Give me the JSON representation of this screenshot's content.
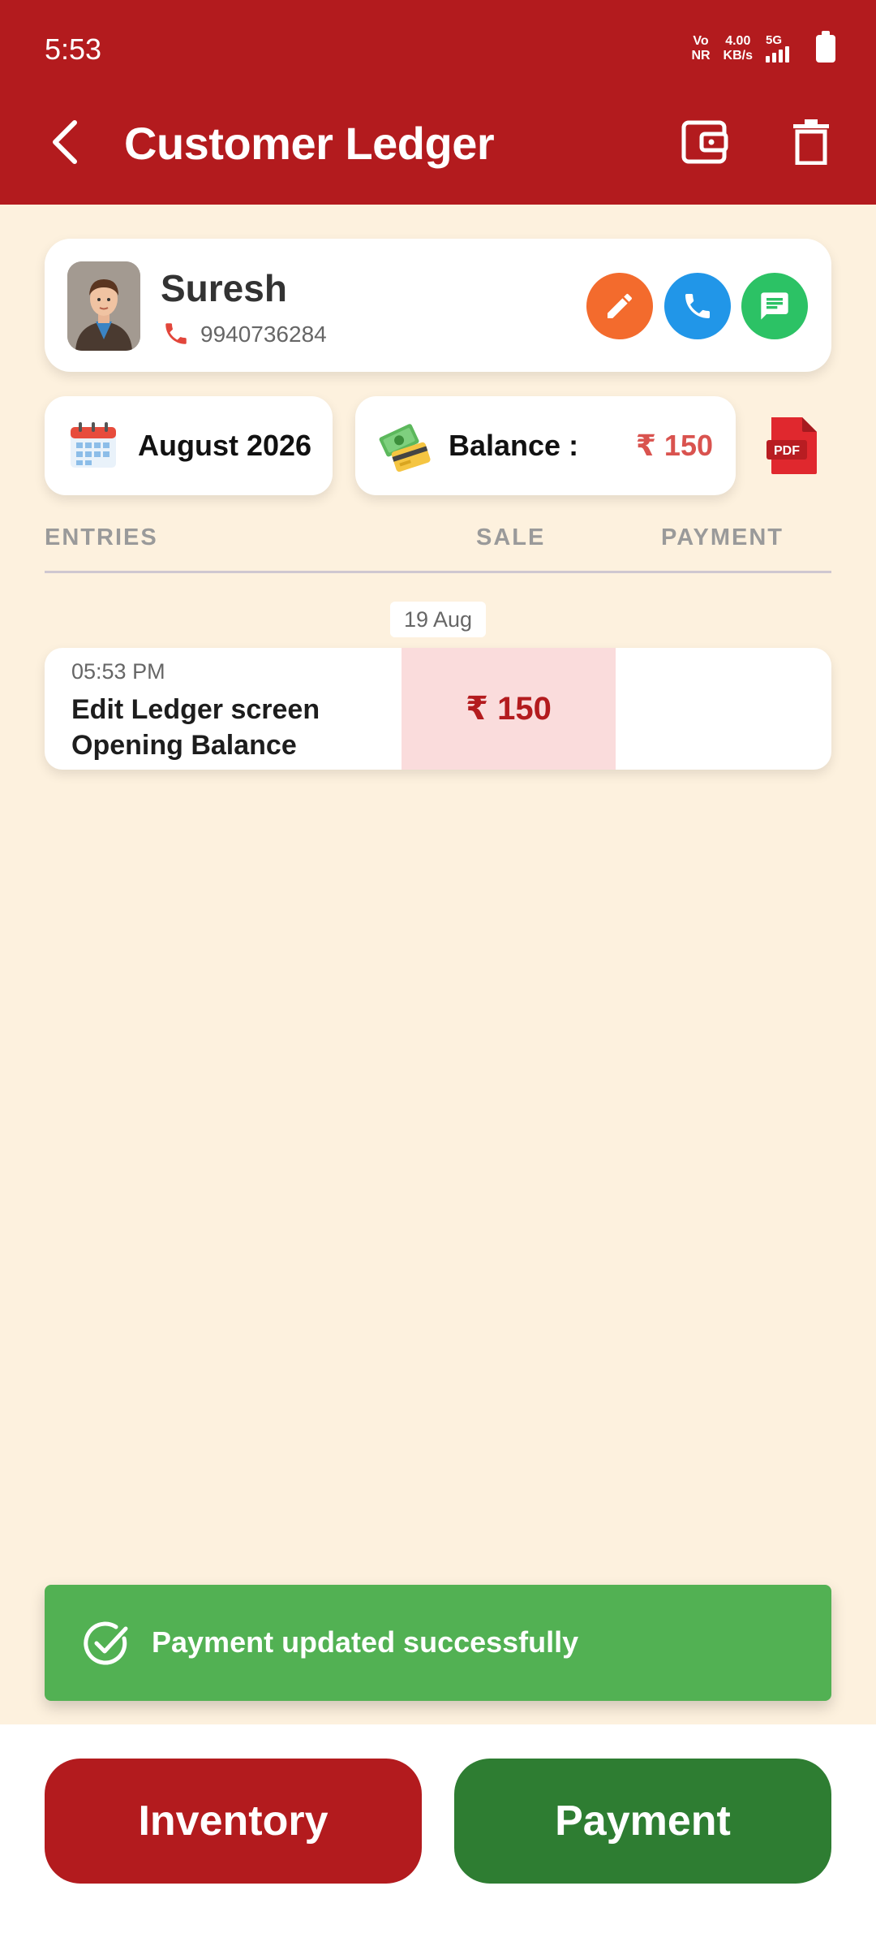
{
  "status_bar": {
    "time": "5:53",
    "volte_top": "Vo",
    "volte_bottom": "NR",
    "speed_top": "4.00",
    "speed_bottom": "KB/s",
    "network": "5G"
  },
  "header": {
    "title": "Customer Ledger",
    "back_icon": "back-arrow-icon",
    "wallet_icon": "wallet-icon",
    "delete_icon": "trash-icon",
    "bg_color": "#b31b1e"
  },
  "customer": {
    "name": "Suresh",
    "phone": "9940736284",
    "actions": [
      {
        "icon": "pencil-icon",
        "color": "#f36b2d"
      },
      {
        "icon": "phone-icon",
        "color": "#2196e8"
      },
      {
        "icon": "message-icon",
        "color": "#2cc265"
      }
    ]
  },
  "period": {
    "month": "August 2026"
  },
  "balance": {
    "label": "Balance :",
    "value": "₹ 150",
    "value_color": "#d9534f"
  },
  "pdf": {
    "label": "PDF"
  },
  "columns": {
    "entries": "ENTRIES",
    "sale": "SALE",
    "payment": "PAYMENT"
  },
  "entries": [
    {
      "date": "19 Aug",
      "time": "05:53 PM",
      "description_line1": "Edit Ledger screen",
      "description_line2": "Opening Balance",
      "sale": "₹ 150",
      "payment": ""
    }
  ],
  "toast": {
    "message": "Payment updated successfully",
    "color": "#52b153"
  },
  "bottom": {
    "inventory_label": "Inventory",
    "payment_label": "Payment",
    "inventory_color": "#b31b1e",
    "payment_color": "#2e7d32"
  }
}
